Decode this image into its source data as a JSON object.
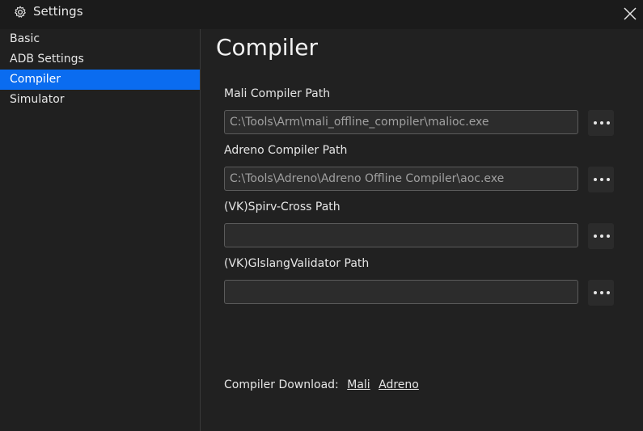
{
  "window": {
    "title": "Settings",
    "settings_icon": "gear-icon",
    "close_icon": "close-icon"
  },
  "sidebar": {
    "items": [
      {
        "label": "Basic",
        "active": false
      },
      {
        "label": "ADB Settings",
        "active": false
      },
      {
        "label": "Compiler",
        "active": true
      },
      {
        "label": "Simulator",
        "active": false
      }
    ]
  },
  "main": {
    "title": "Compiler",
    "fields": [
      {
        "label": "Mali Compiler Path",
        "value": "C:\\Tools\\Arm\\mali_offline_compiler\\malioc.exe"
      },
      {
        "label": "Adreno Compiler Path",
        "value": "C:\\Tools\\Adreno\\Adreno Offline Compiler\\aoc.exe"
      },
      {
        "label": "(VK)Spirv-Cross Path",
        "value": ""
      },
      {
        "label": "(VK)GlslangValidator Path",
        "value": ""
      }
    ],
    "browse_icon": "more-horizontal-icon",
    "download": {
      "label": "Compiler Download:",
      "links": [
        "Mali",
        "Adreno"
      ]
    }
  },
  "colors": {
    "accent": "#0a6cf0",
    "background": "#202020",
    "titlebar": "#1b1b1b"
  }
}
